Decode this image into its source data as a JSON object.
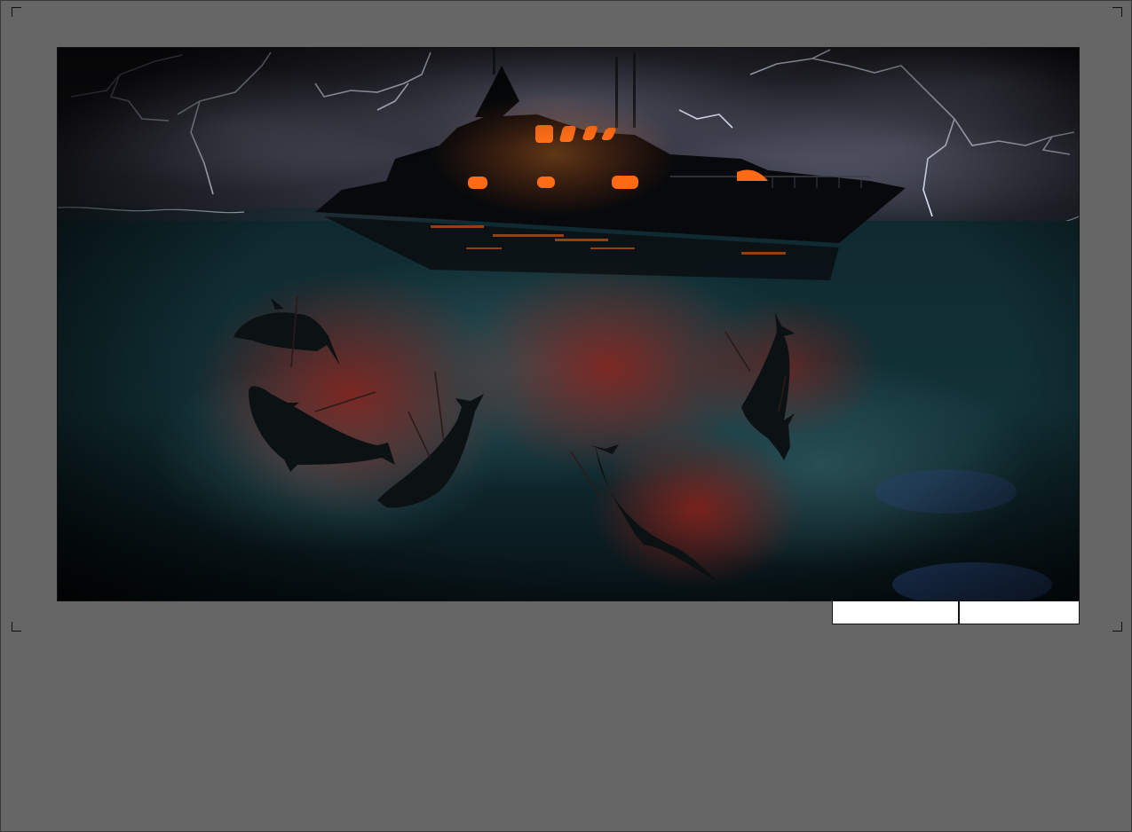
{
  "document": {
    "panel": {
      "illustration": "storm-ship-dolphins",
      "caption_left": "",
      "caption_right": ""
    }
  },
  "colors": {
    "page_background": "#666666",
    "sky_dark": "#1a1c24",
    "sea_dark": "#0b1c20",
    "window_glow": "#ff6a14",
    "blood_red": "#8a1a12",
    "lightning": "#e8eeff"
  }
}
